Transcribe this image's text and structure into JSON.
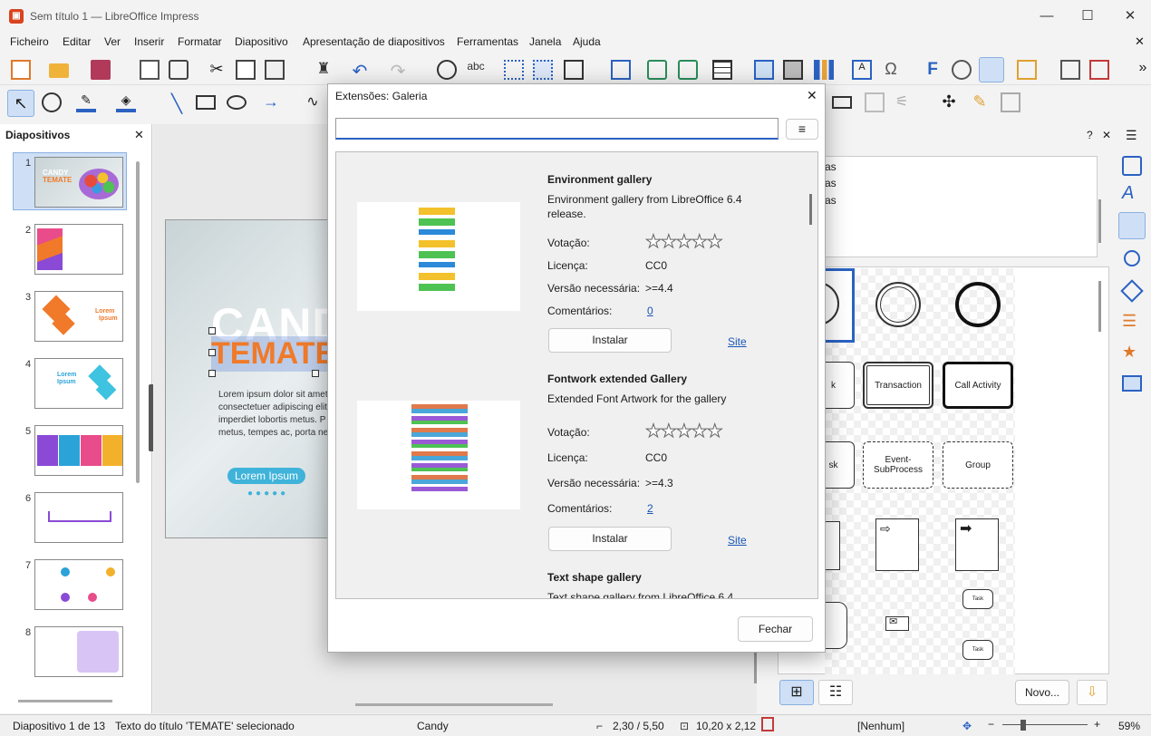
{
  "window": {
    "title": "Sem título 1 — LibreOffice Impress",
    "minimize": "—",
    "maximize": "☐",
    "close": "✕",
    "doc_close": "✕"
  },
  "menu": [
    "Ficheiro",
    "Editar",
    "Ver",
    "Inserir",
    "Formatar",
    "Diapositivo",
    "Apresentação de diapositivos",
    "Ferramentas",
    "Janela",
    "Ajuda"
  ],
  "slides_panel": {
    "title": "Diapositivos",
    "close": "✕",
    "numbers": [
      "1",
      "2",
      "3",
      "4",
      "5",
      "6",
      "7",
      "8"
    ]
  },
  "slide": {
    "title1": "CANDY",
    "title2": "TEMATE",
    "body": "Lorem ipsum dolor sit amet, consectetuer adipiscing elit, imperdiet lobortis metus. P metus, tempes ac, porta ne",
    "button": "Lorem Ipsum"
  },
  "thumb1": {
    "title1": "CANDY",
    "title2": "TEMATE"
  },
  "thumb3": {
    "lorem": "Lorem",
    "ipsum": "Ipsum"
  },
  "thumb4": {
    "lorem": "Lorem",
    "ipsum": "Ipsum"
  },
  "right_panel": {
    "help": "?",
    "close": "✕",
    "menu": "☰",
    "themes": [
      "as",
      "as",
      "as"
    ],
    "new_button": "Novo...",
    "shapes": {
      "transaction": "Transaction",
      "call_activity": "Call Activity",
      "event_subprocess": "Event-SubProcess",
      "group": "Group",
      "task_a": "k",
      "task_b": "sk",
      "task_small_1": "Task",
      "task_small_2": "Task"
    }
  },
  "dialog": {
    "title": "Extensões: Galeria",
    "close": "✕",
    "search_value": "",
    "menu_icon": "≡",
    "close_button": "Fechar",
    "items": [
      {
        "name": "Environment gallery",
        "desc_line1": "Environment gallery from LibreOffice 6.4",
        "desc_line2": "release.",
        "rating_label": "Votação:",
        "license_label": "Licença:",
        "license": "CC0",
        "version_label": "Versão necessária:",
        "version": ">=4.4",
        "comments_label": "Comentários:",
        "comments": "0",
        "install": "Instalar",
        "site": "Site"
      },
      {
        "name": "Fontwork extended Gallery",
        "desc_line1": "Extended Font Artwork for the gallery",
        "desc_line2": "",
        "rating_label": "Votação:",
        "license_label": "Licença:",
        "license": "CC0",
        "version_label": "Versão necessária:",
        "version": ">=4.3",
        "comments_label": "Comentários:",
        "comments": "2",
        "install": "Instalar",
        "site": "Site"
      },
      {
        "name": "Text shape gallery",
        "desc_line1": "Text shape gallery from LibreOffice 6.4"
      }
    ]
  },
  "status": {
    "slide_info": "Diapositivo 1 de 13",
    "selection": "Texto do título 'TEMATE' selecionado",
    "master": "Candy",
    "position": "2,30 / 5,50",
    "size": "10,20 x 2,12",
    "layout": "[Nenhum]",
    "zoom": "59%"
  },
  "colors": {
    "accent": "#f07a2a",
    "blue": "#2b62c2",
    "brand": "#d9431e"
  }
}
